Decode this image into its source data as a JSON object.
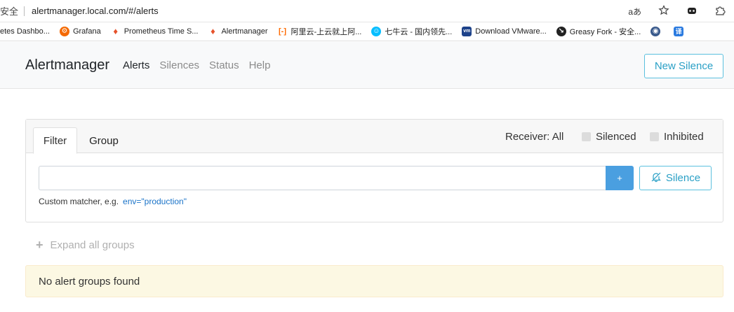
{
  "browser": {
    "security_label": "安全",
    "url": "alertmanager.local.com/#/alerts",
    "right_icons": [
      "read-aloud-icon",
      "favorite-icon",
      "extension-icon",
      "puzzle-icon"
    ],
    "read_aloud_glyph": "aあ"
  },
  "bookmarks": [
    {
      "label": "etes Dashbo...",
      "icon": "kubernetes-icon",
      "color": "#326ce5"
    },
    {
      "label": "Grafana",
      "icon": "grafana-icon",
      "color": "#f46800"
    },
    {
      "label": "Prometheus Time S...",
      "icon": "prometheus-icon",
      "color": "#e6522c"
    },
    {
      "label": "Alertmanager",
      "icon": "prometheus-icon",
      "color": "#e6522c"
    },
    {
      "label": "阿里云-上云就上阿...",
      "icon": "aliyun-icon",
      "color": "#ff6a00"
    },
    {
      "label": "七牛云 - 国内领先...",
      "icon": "qiniu-icon",
      "color": "#07beff"
    },
    {
      "label": "Download VMware...",
      "icon": "vmware-icon",
      "color": "#1d428a"
    },
    {
      "label": "Greasy Fork - 安全...",
      "icon": "greasyfork-icon",
      "color": "#222222"
    },
    {
      "label": "",
      "icon": "globe-icon",
      "color": "#3a5a8c"
    },
    {
      "label": "",
      "icon": "translate-icon",
      "color": "#2b7be0"
    }
  ],
  "navbar": {
    "brand": "Alertmanager",
    "links": [
      {
        "label": "Alerts",
        "active": true
      },
      {
        "label": "Silences",
        "active": false
      },
      {
        "label": "Status",
        "active": false
      },
      {
        "label": "Help",
        "active": false
      }
    ],
    "new_silence_label": "New Silence"
  },
  "filter": {
    "tabs": [
      "Filter",
      "Group"
    ],
    "receiver_label": "Receiver: All",
    "silenced_label": "Silenced",
    "inhibited_label": "Inhibited",
    "input_value": "",
    "add_label": "+",
    "silence_label": "Silence",
    "hint_prefix": "Custom matcher, e.g.",
    "hint_example": "env=\"production\""
  },
  "groups": {
    "expand_label": "Expand all groups",
    "empty_message": "No alert groups found"
  },
  "colors": {
    "accent": "#5bc0de",
    "primary": "#4a9fe0",
    "warning_bg": "#fcf8e3"
  }
}
